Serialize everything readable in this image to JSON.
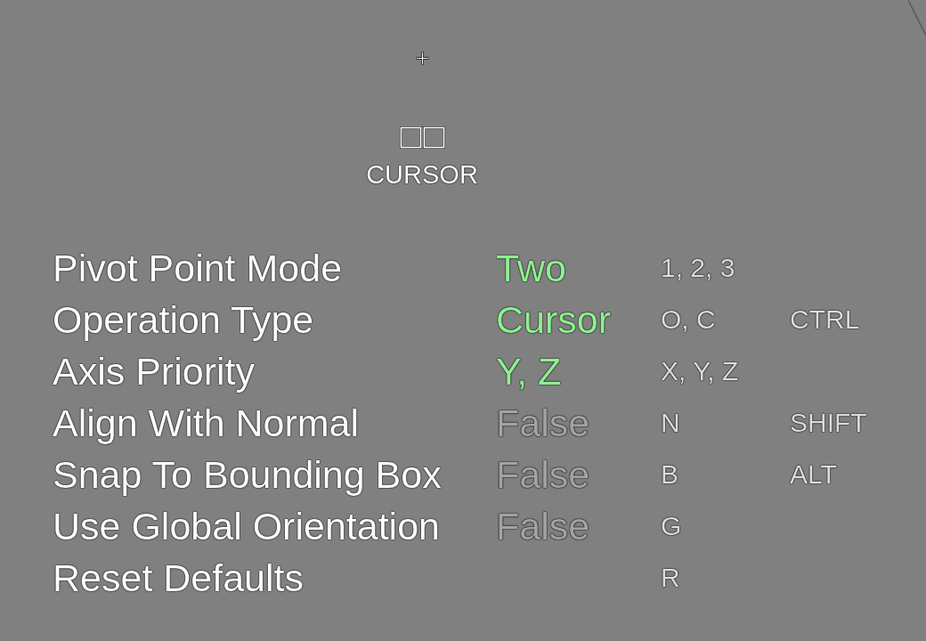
{
  "header": {
    "title": "CURSOR"
  },
  "rows": [
    {
      "label": "Pivot Point Mode",
      "value": "Two",
      "highlighted": true,
      "keys": "1, 2, 3"
    },
    {
      "label": "Operation Type",
      "value": "Cursor",
      "highlighted": true,
      "keys": "O, C",
      "modifier": "CTRL"
    },
    {
      "label": "Axis Priority",
      "value": "Y, Z",
      "highlighted": true,
      "keys": "X, Y, Z"
    },
    {
      "label": "Align With Normal",
      "value": "False",
      "highlighted": false,
      "keys": "N",
      "modifier": "SHIFT"
    },
    {
      "label": "Snap To Bounding Box",
      "value": "False",
      "highlighted": false,
      "keys": "B",
      "modifier": "ALT"
    },
    {
      "label": "Use Global Orientation",
      "value": "False",
      "highlighted": false,
      "keys": "G"
    },
    {
      "label": "Reset Defaults",
      "keys": "R"
    }
  ]
}
